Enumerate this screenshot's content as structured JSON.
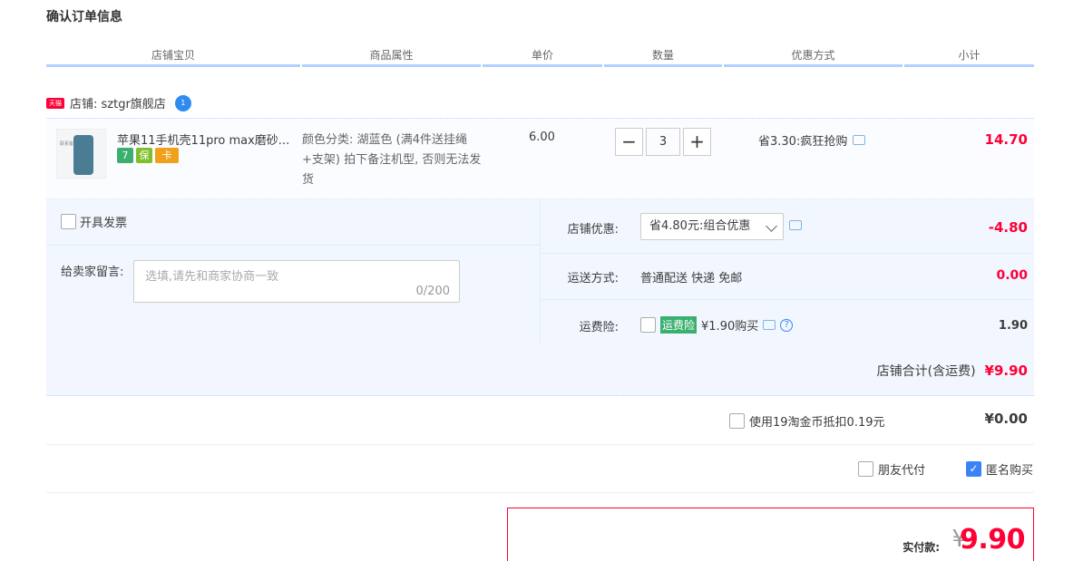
{
  "page": {
    "title": "确认订单信息"
  },
  "columns": [
    "店铺宝贝",
    "商品属性",
    "单价",
    "数量",
    "优惠方式",
    "小计"
  ],
  "shop": {
    "badge": "天猫",
    "name_label": "店铺: sztgr旗舰店",
    "wangwang": "1"
  },
  "item": {
    "name": "苹果11手机壳11pro max磨砂...",
    "thumb_text": "联系客服",
    "service_icons": [
      {
        "text": "7",
        "color": "#3ab06e"
      },
      {
        "text": "保",
        "color": "#7fbf2a"
      },
      {
        "text": "卡",
        "color": "#f0a01a"
      }
    ],
    "attributes": "颜色分类: 湖蓝色 (满4件送挂绳+支架) 拍下备注机型, 否则无法发货",
    "unit_price": "6.00",
    "quantity": "3",
    "minus": "−",
    "plus": "+",
    "discount": "省3.30:疯狂抢购",
    "subtotal": "14.70"
  },
  "options": {
    "invoice_label": "开具发票",
    "message_label": "给卖家留言:",
    "message_placeholder": "选填,请先和商家协商一致",
    "message_count": "0/200",
    "shop_coupon_label": "店铺优惠:",
    "shop_coupon_value": "省4.80元:组合优惠",
    "shop_coupon_amount": "-4.80",
    "shipping_label": "运送方式:",
    "shipping_value": "普通配送 快递 免邮",
    "shipping_amount": "0.00",
    "insurance_label": "运费险:",
    "insurance_badge": "运费险",
    "insurance_text": "¥1.90购买",
    "insurance_amount": "1.90",
    "help": "?"
  },
  "shop_total": {
    "label": "店铺合计(含运费)",
    "amount": "¥9.90"
  },
  "coins": {
    "label": "使用19淘金币抵扣0.19元",
    "amount": "¥0.00"
  },
  "friend_pay_label": "朋友代付",
  "anonymous_label": "匿名购买",
  "anonymous_checked": "✓",
  "payment": {
    "label": "实付款:",
    "currency": "¥",
    "amount": "9.90"
  },
  "colors": {
    "accent_red": "#ff0036",
    "header_line": "#b2d1ff",
    "panel_bg": "#f2f7ff",
    "check_blue": "#3b83f5"
  }
}
